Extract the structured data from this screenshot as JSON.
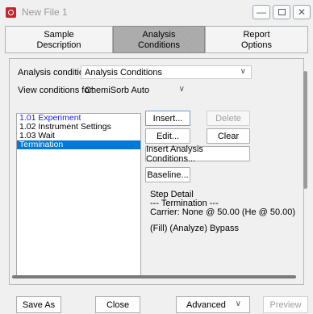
{
  "window": {
    "title": "New File 1"
  },
  "tabs": [
    {
      "line1": "Sample",
      "line2": "Description"
    },
    {
      "line1": "Analysis",
      "line2": "Conditions"
    },
    {
      "line1": "Report",
      "line2": "Options"
    }
  ],
  "form": {
    "analysis_conditions_label": "Analysis conditions:",
    "analysis_conditions_value": "Analysis Conditions",
    "view_conditions_label": "View conditions for:",
    "view_conditions_value": "ChemiSorb Auto"
  },
  "steps": [
    {
      "label": "1.01  Experiment",
      "color": "#1a1aff",
      "selected": false
    },
    {
      "label": "1.02  Instrument Settings",
      "color": "#000000",
      "selected": false
    },
    {
      "label": "1.03  Wait",
      "color": "#000000",
      "selected": false
    },
    {
      "label": "Termination",
      "color": "#ffffff",
      "selected": true
    }
  ],
  "buttons": {
    "insert": "Insert...",
    "delete": "Delete",
    "edit": "Edit...",
    "clear": "Clear",
    "insert_conditions": "Insert Analysis Conditions...",
    "baseline": "Baseline..."
  },
  "detail": {
    "title": "Step Detail",
    "line1": "--- Termination ---",
    "line2": "Carrier: None @ 50.00   (He @ 50.00)",
    "line3": "(Fill)  (Analyze)  Bypass"
  },
  "bottom": {
    "save_as": "Save As",
    "close": "Close",
    "advanced": "Advanced",
    "preview": "Preview"
  },
  "colors": {
    "selection": "#0078d7",
    "accent": "#c0282d"
  }
}
